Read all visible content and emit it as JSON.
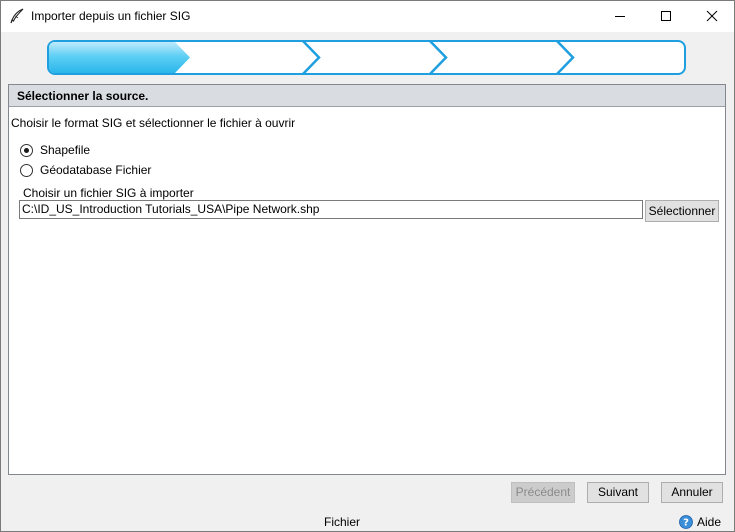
{
  "window": {
    "title": "Importer depuis un fichier SIG",
    "controls": {
      "minimize": "minimize",
      "maximize": "maximize",
      "close": "close"
    }
  },
  "wizard": {
    "steps_count": 5,
    "active_step": 1,
    "colors": {
      "active": "#3cc3f0",
      "active_light": "#bfeafb",
      "border": "#1f9fe0"
    }
  },
  "section": {
    "title": "Sélectionner la source.",
    "instruction": "Choisir le format SIG et sélectionner le fichier à ouvrir"
  },
  "format_options": [
    {
      "label": "Shapefile",
      "checked": true
    },
    {
      "label": "Géodatabase Fichier",
      "checked": false
    }
  ],
  "file": {
    "label": "Choisir un fichier SIG à importer",
    "value": "C:\\ID_US_Introduction Tutorials_USA\\Pipe Network.shp",
    "select_button": "Sélectionner"
  },
  "footer": {
    "previous": "Précédent",
    "next": "Suivant",
    "cancel": "Annuler"
  },
  "status": {
    "text": "Fichier",
    "help": "Aide"
  }
}
